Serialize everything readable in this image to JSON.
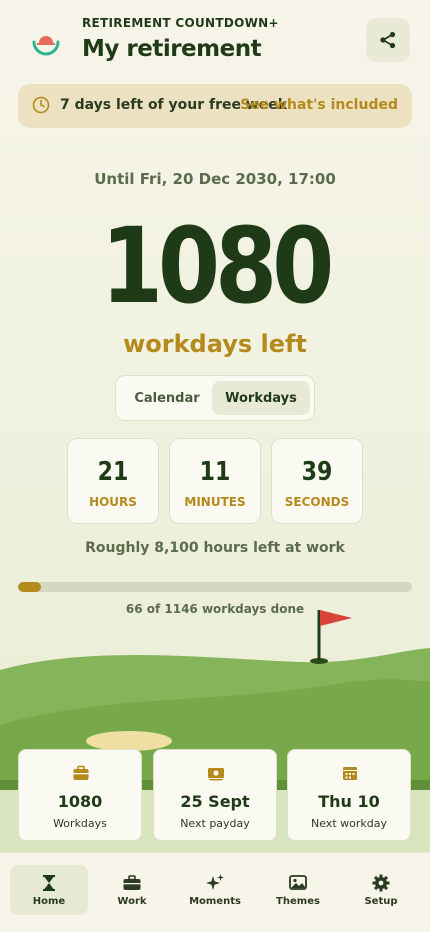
{
  "header": {
    "brand": "RETIREMENT COUNTDOWN+",
    "title": "My retirement",
    "share_icon": "share-icon"
  },
  "trial_banner": {
    "text": "7 days left of your free week",
    "link": "See what's included",
    "icon": "clock-icon"
  },
  "countdown": {
    "until": "Until Fri, 20 Dec 2030, 17:00",
    "big_number": "1080",
    "big_label": "workdays left",
    "mode_tabs": [
      {
        "label": "Calendar",
        "selected": false
      },
      {
        "label": "Workdays",
        "selected": true
      }
    ],
    "hours": {
      "value": "21",
      "label": "HOURS"
    },
    "minutes": {
      "value": "11",
      "label": "MINUTES"
    },
    "seconds": {
      "value": "39",
      "label": "SECONDS"
    },
    "roughly": "Roughly 8,100 hours left at work",
    "progress_fraction": 0.0576,
    "done_text": "66 of 1146 workdays done"
  },
  "stats": [
    {
      "value": "1080",
      "label": "Workdays",
      "icon": "briefcase-icon"
    },
    {
      "value": "25 Sept",
      "label": "Next payday",
      "icon": "cash-icon"
    },
    {
      "value": "Thu 10",
      "label": "Next workday",
      "icon": "calendar-icon"
    }
  ],
  "nav": [
    {
      "label": "Home",
      "icon": "hourglass-icon",
      "active": true
    },
    {
      "label": "Work",
      "icon": "briefcase-icon",
      "active": false
    },
    {
      "label": "Moments",
      "icon": "sparkles-icon",
      "active": false
    },
    {
      "label": "Themes",
      "icon": "image-icon",
      "active": false
    },
    {
      "label": "Setup",
      "icon": "gear-icon",
      "active": false
    }
  ],
  "colors": {
    "accent_gold": "#b58a1c",
    "dark_green": "#1f3a17",
    "grass": "#7aab4f",
    "flag": "#d8443a"
  }
}
